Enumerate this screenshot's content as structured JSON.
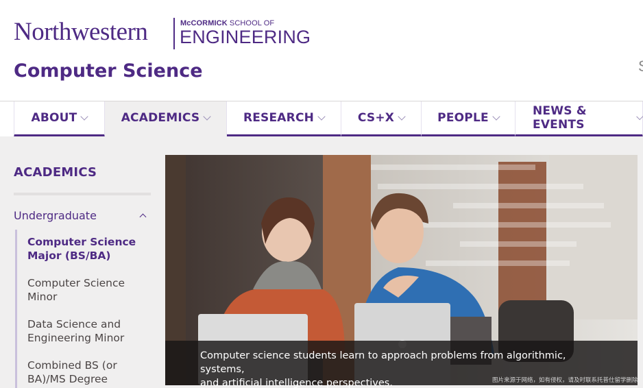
{
  "header": {
    "university": "Northwestern",
    "school_line_bold": "McCORMICK",
    "school_line_rest": " SCHOOL OF",
    "school_name": "ENGINEERING",
    "site_title": "Computer Science",
    "edge_glyph": "S"
  },
  "nav": {
    "items": [
      {
        "label": "ABOUT",
        "active": false
      },
      {
        "label": "ACADEMICS",
        "active": true
      },
      {
        "label": "RESEARCH",
        "active": false
      },
      {
        "label": "CS+X",
        "active": false
      },
      {
        "label": "PEOPLE",
        "active": false
      },
      {
        "label": "NEWS & EVENTS",
        "active": false
      }
    ]
  },
  "sidebar": {
    "title": "ACADEMICS",
    "group": "Undergraduate",
    "links": [
      {
        "label_lines": [
          "Computer Science",
          "Major (BS/BA)"
        ],
        "current": true
      },
      {
        "label_lines": [
          "Computer Science",
          "Minor"
        ],
        "current": false
      },
      {
        "label_lines": [
          "Data Science and",
          "Engineering Minor"
        ],
        "current": false
      },
      {
        "label_lines": [
          "Combined BS (or",
          "BA)/MS Degree"
        ],
        "current": false
      }
    ]
  },
  "hero": {
    "caption_lines": [
      "Computer science students learn to approach problems from algorithmic, systems,",
      "and artificial intelligence perspectives."
    ]
  },
  "watermark": "图片来源于网络，如有侵权，请及时联系托普仕留学删除",
  "colors": {
    "brand_purple": "#4e2a84",
    "page_background": "#f0efef",
    "caption_background": "#181616"
  },
  "icons": [
    "chevron-down-icon",
    "chevron-up-icon"
  ]
}
